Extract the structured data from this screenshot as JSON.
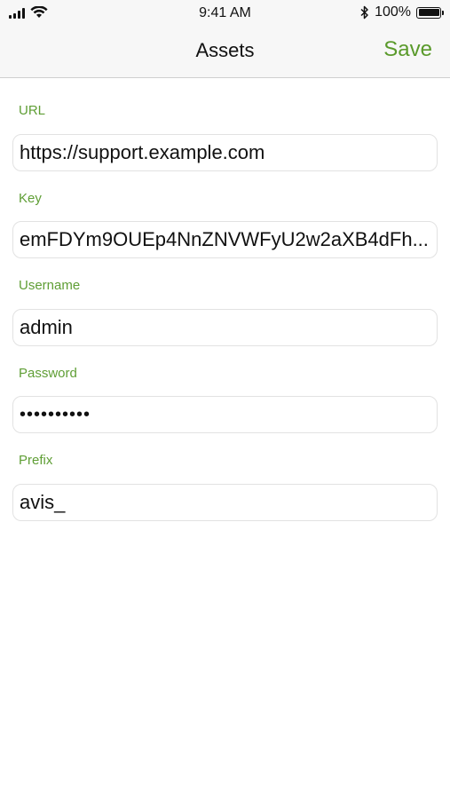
{
  "status_bar": {
    "time": "9:41 AM",
    "battery_text": "100%",
    "battery_level": 1.0,
    "icons": [
      "signal-icon",
      "wifi-icon",
      "bluetooth-icon",
      "battery-icon"
    ]
  },
  "nav": {
    "title": "Assets",
    "save_label": "Save",
    "accent_color": "#5a9a2b"
  },
  "fields": {
    "url": {
      "label": "URL",
      "value": "https://support.example.com"
    },
    "key": {
      "label": "Key",
      "value": "emFDYm9OUEp4NnZNVWFyU2w2aXB4dFh..."
    },
    "username": {
      "label": "Username",
      "value": "admin"
    },
    "password": {
      "label": "Password",
      "value": "••••••••••"
    },
    "prefix": {
      "label": "Prefix",
      "value": "avis_"
    }
  }
}
